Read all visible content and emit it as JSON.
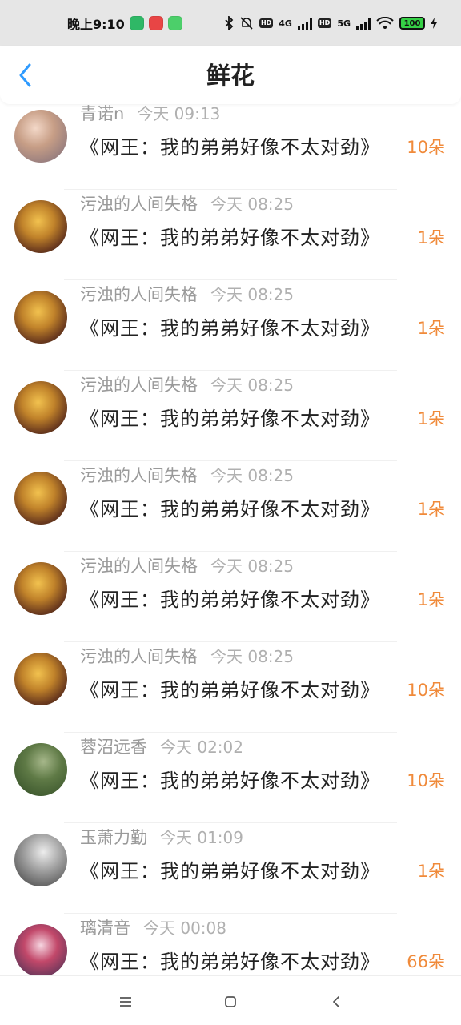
{
  "status_bar": {
    "time": "晚上9:10",
    "network_4g": "4G",
    "network_5g": "5G",
    "hd_label": "HD",
    "battery": "100",
    "app_icons": [
      "green-app-icon",
      "red-app-icon",
      "green-app-icon"
    ]
  },
  "header": {
    "title": "鲜花",
    "back_icon": "chevron-left-icon",
    "accent": "#2f9bff"
  },
  "colors": {
    "amount": "#f08a3a",
    "meta": "#9a9a9a",
    "title": "#222222",
    "status_bar_bg": "#e6e6e6"
  },
  "gifts": [
    {
      "user": "青诺n",
      "time": "今天 09:13",
      "book": "《网王：我的弟弟好像不太对劲》",
      "amount": "10朵"
    },
    {
      "user": "污浊的人间失格",
      "time": "今天 08:25",
      "book": "《网王：我的弟弟好像不太对劲》",
      "amount": "1朵"
    },
    {
      "user": "污浊的人间失格",
      "time": "今天 08:25",
      "book": "《网王：我的弟弟好像不太对劲》",
      "amount": "1朵"
    },
    {
      "user": "污浊的人间失格",
      "time": "今天 08:25",
      "book": "《网王：我的弟弟好像不太对劲》",
      "amount": "1朵"
    },
    {
      "user": "污浊的人间失格",
      "time": "今天 08:25",
      "book": "《网王：我的弟弟好像不太对劲》",
      "amount": "1朵"
    },
    {
      "user": "污浊的人间失格",
      "time": "今天 08:25",
      "book": "《网王：我的弟弟好像不太对劲》",
      "amount": "1朵"
    },
    {
      "user": "污浊的人间失格",
      "time": "今天 08:25",
      "book": "《网王：我的弟弟好像不太对劲》",
      "amount": "10朵"
    },
    {
      "user": "蓉沼远香",
      "time": "今天 02:02",
      "book": "《网王：我的弟弟好像不太对劲》",
      "amount": "10朵"
    },
    {
      "user": "玉萧力勤",
      "time": "今天 01:09",
      "book": "《网王：我的弟弟好像不太对劲》",
      "amount": "1朵"
    },
    {
      "user": "璃清音",
      "time": "今天 00:08",
      "book": "《网王：我的弟弟好像不太对劲》",
      "amount": "66朵"
    }
  ],
  "nav_bar": {
    "icons": [
      "menu-icon",
      "home-icon",
      "back-icon"
    ]
  }
}
